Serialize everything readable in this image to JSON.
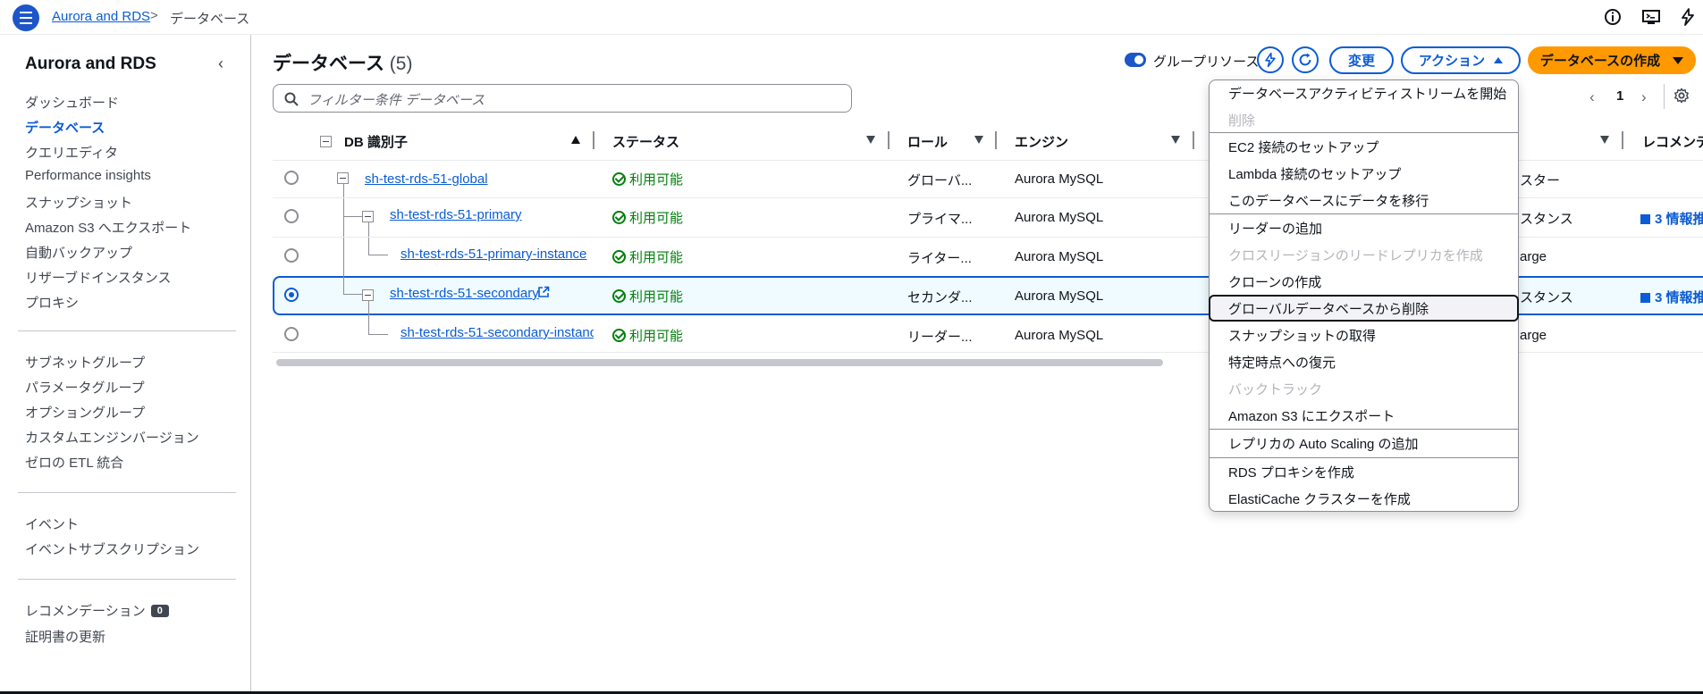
{
  "topbar": {
    "breadcrumb_service": "Aurora and RDS",
    "breadcrumb_separator": ">",
    "breadcrumb_current": "データベース",
    "icons": [
      "menu-icon",
      "info-icon",
      "cloudshell-icon",
      "notifications-icon"
    ]
  },
  "sidebar": {
    "title": "Aurora and RDS",
    "group1": [
      "ダッシュボード",
      "データベース",
      "クエリエディタ",
      "Performance insights",
      "スナップショット",
      "Amazon S3 へエクスポート",
      "自動バックアップ",
      "リザーブドインスタンス",
      "プロキシ"
    ],
    "group2": [
      "サブネットグループ",
      "パラメータグループ",
      "オプショングループ",
      "カスタムエンジンバージョン",
      "ゼロの ETL 統合"
    ],
    "group3": [
      "イベント",
      "イベントサブスクリプション"
    ],
    "recommendations_label": "レコメンデーション",
    "recommendations_count": "0",
    "cert_update": "証明書の更新",
    "active_item": "データベース"
  },
  "header": {
    "title": "データベース",
    "count": "(5)",
    "group_resources_label": "グループリソース",
    "group_resources_on": true,
    "modify_label": "変更",
    "actions_label": "アクション",
    "create_label": "データベースの作成"
  },
  "search": {
    "placeholder": "フィルター条件 データベース"
  },
  "pagination": {
    "page": "1"
  },
  "table": {
    "headers": {
      "db_id": "DB 識別子",
      "status": "ステータス",
      "role": "ロール",
      "engine": "エンジン",
      "recommendation": "レコメンデ"
    },
    "rows": [
      {
        "id": "sh-test-rds-51-global",
        "status": "利用可能",
        "role": "グローバ...",
        "engine": "Aurora MySQL",
        "size": "スター",
        "rec": "",
        "selected": false
      },
      {
        "id": "sh-test-rds-51-primary",
        "status": "利用可能",
        "role": "プライマ...",
        "engine": "Aurora MySQL",
        "size": "スタンス",
        "rec": "3 情報推",
        "selected": false
      },
      {
        "id": "sh-test-rds-51-primary-instance",
        "status": "利用可能",
        "role": "ライター...",
        "engine": "Aurora MySQL",
        "size": "arge",
        "rec": "",
        "selected": false
      },
      {
        "id": "sh-test-rds-51-secondary",
        "status": "利用可能",
        "role": "セカンダ...",
        "engine": "Aurora MySQL",
        "size": "スタンス",
        "rec": "3 情報推",
        "selected": true
      },
      {
        "id": "sh-test-rds-51-secondary-instance",
        "status": "利用可能",
        "role": "リーダー...",
        "engine": "Aurora MySQL",
        "size": "arge",
        "rec": "",
        "selected": false
      }
    ]
  },
  "actions_menu": {
    "items": [
      {
        "label": "データベースアクティビティストリームを開始",
        "disabled": false
      },
      {
        "label": "削除",
        "disabled": true
      },
      {
        "label": "EC2 接続のセットアップ",
        "disabled": false
      },
      {
        "label": "Lambda 接続のセットアップ",
        "disabled": false
      },
      {
        "label": "このデータベースにデータを移行",
        "disabled": false
      },
      {
        "label": "リーダーの追加",
        "disabled": false
      },
      {
        "label": "クロスリージョンのリードレプリカを作成",
        "disabled": true
      },
      {
        "label": "クローンの作成",
        "disabled": false
      },
      {
        "label": "グローバルデータベースから削除",
        "disabled": false,
        "highlighted": true
      },
      {
        "label": "スナップショットの取得",
        "disabled": false
      },
      {
        "label": "特定時点への復元",
        "disabled": false
      },
      {
        "label": "バックトラック",
        "disabled": true
      },
      {
        "label": "Amazon S3 にエクスポート",
        "disabled": false
      },
      {
        "label": "レプリカの Auto Scaling の追加",
        "disabled": false
      },
      {
        "label": "RDS プロキシを作成",
        "disabled": false
      },
      {
        "label": "ElastiCache クラスターを作成",
        "disabled": false
      }
    ]
  },
  "colors": {
    "accent": "#0b5cd5",
    "primary_button": "#ff9900",
    "success": "#037f0c",
    "disabled": "#b4b4bb"
  }
}
